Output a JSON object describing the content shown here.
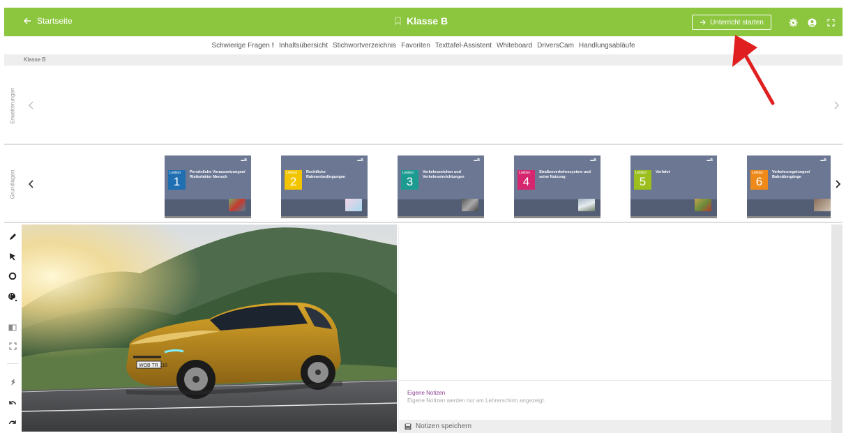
{
  "topbar": {
    "back_label": "Startseite",
    "title": "Klasse B",
    "start_button_label": "Unterricht starten",
    "icons": [
      "gear-icon",
      "user-circle-icon",
      "fullscreen-icon"
    ]
  },
  "nav": {
    "items": [
      "Schwierige Fragen",
      "!",
      "Inhaltsübersicht",
      "Stichwortverzeichnis",
      "Favoriten",
      "Texttafel-Assistent",
      "Whiteboard",
      "DriversCam",
      "Handlungsabläufe"
    ]
  },
  "breadcrumb": "Klasse B",
  "sections": {
    "erweiterungen_label": "Erweiterungen",
    "grundlagen_label": "Grundlagen"
  },
  "lessons": [
    {
      "prefix": "Lektion",
      "number": "1",
      "title": "Persönliche Voraussetzungen/ Risikofaktor Mensch",
      "color": "#1f6fb2",
      "logo": "B"
    },
    {
      "prefix": "Lektion",
      "number": "2",
      "title": "Rechtliche Rahmenbedingungen",
      "color": "#f2c500",
      "logo": "B"
    },
    {
      "prefix": "Lektion",
      "number": "3",
      "title": "Verkehrszeichen und Verkehrseinrichtungen",
      "color": "#1c9c91",
      "logo": "B"
    },
    {
      "prefix": "Lektion",
      "number": "4",
      "title": "Straßenverkehrssystem und seine Nutzung",
      "color": "#d6266f",
      "logo": "B"
    },
    {
      "prefix": "Lektion",
      "number": "5",
      "title": "Vorfahrt",
      "color": "#9cbf1e",
      "logo": "B"
    },
    {
      "prefix": "Lektion",
      "number": "6",
      "title": "Verkehrsregelungen/ Bahnübergänge",
      "color": "#ef8a1a",
      "logo": "B"
    }
  ],
  "tools": [
    "pencil-icon",
    "pointer-icon",
    "circle-icon",
    "palette-icon",
    "book-icon",
    "expand-icon",
    "pin-icon",
    "undo-icon",
    "redo-icon"
  ],
  "image": {
    "plate": "WOB TR 116"
  },
  "notes": {
    "title": "Eigene Notizen",
    "hint": "Eigene Notizen werden nur am Lehrerschirm angezeigt.",
    "save_label": "Notizen speichern"
  }
}
